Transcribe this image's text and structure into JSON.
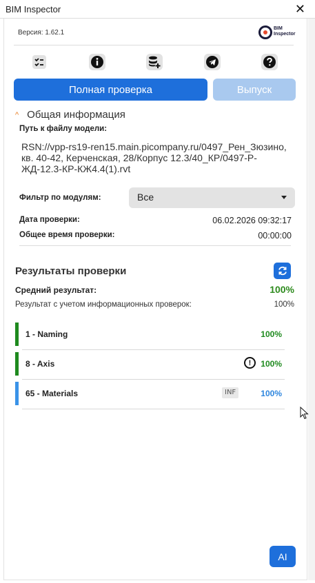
{
  "window": {
    "title": "BIM Inspector",
    "close_glyph": "✕"
  },
  "header": {
    "version_label": "Версия:",
    "version": "1.62.1",
    "logo_text_1": "BIM",
    "logo_text_2": "Inspector"
  },
  "toolbar": {
    "icons": [
      "checklist-icon",
      "info-icon",
      "database-add-icon",
      "telegram-icon",
      "help-icon"
    ]
  },
  "actions": {
    "full_check": "Полная проверка",
    "release": "Выпуск"
  },
  "general": {
    "section_title": "Общая информация",
    "path_label": "Путь к файлу модели:",
    "path_value": "RSN://vpp-rs19-ren15.main.picompany.ru/0497_Рен_Зюзино, кв. 40-42, Керченская, 28/Корпус 12.3/40_КР/0497-Р-ЖД-12.3-КР-КЖ4.4(1).rvt",
    "filter_label": "Фильтр по модулям:",
    "filter_value": "Все",
    "date_label": "Дата проверки:",
    "date_value": "06.02.2026 09:32:17",
    "total_time_label": "Общее время проверки:",
    "total_time_value": "00:00:00"
  },
  "results": {
    "title": "Результаты проверки",
    "avg_label": "Средний результат:",
    "avg_value": "100%",
    "info_label": "Результат с учетом информационных проверок:",
    "info_value": "100%",
    "modules": [
      {
        "name": "1 - Naming",
        "pct": "100%",
        "color": "#1e8a1e",
        "bar": "#1e8a1e",
        "badge": ""
      },
      {
        "name": "8 - Axis",
        "pct": "100%",
        "color": "#1e8a1e",
        "bar": "#1e8a1e",
        "badge": "warning"
      },
      {
        "name": "65 - Materials",
        "pct": "100%",
        "color": "#2e86de",
        "bar": "#3a93e8",
        "badge": "INF"
      }
    ]
  },
  "ai_button": "AI",
  "colors": {
    "primary": "#1e6fdb",
    "primary_disabled": "#a9c9ef",
    "success": "#2e8b1e",
    "accent": "#e87a1e"
  }
}
